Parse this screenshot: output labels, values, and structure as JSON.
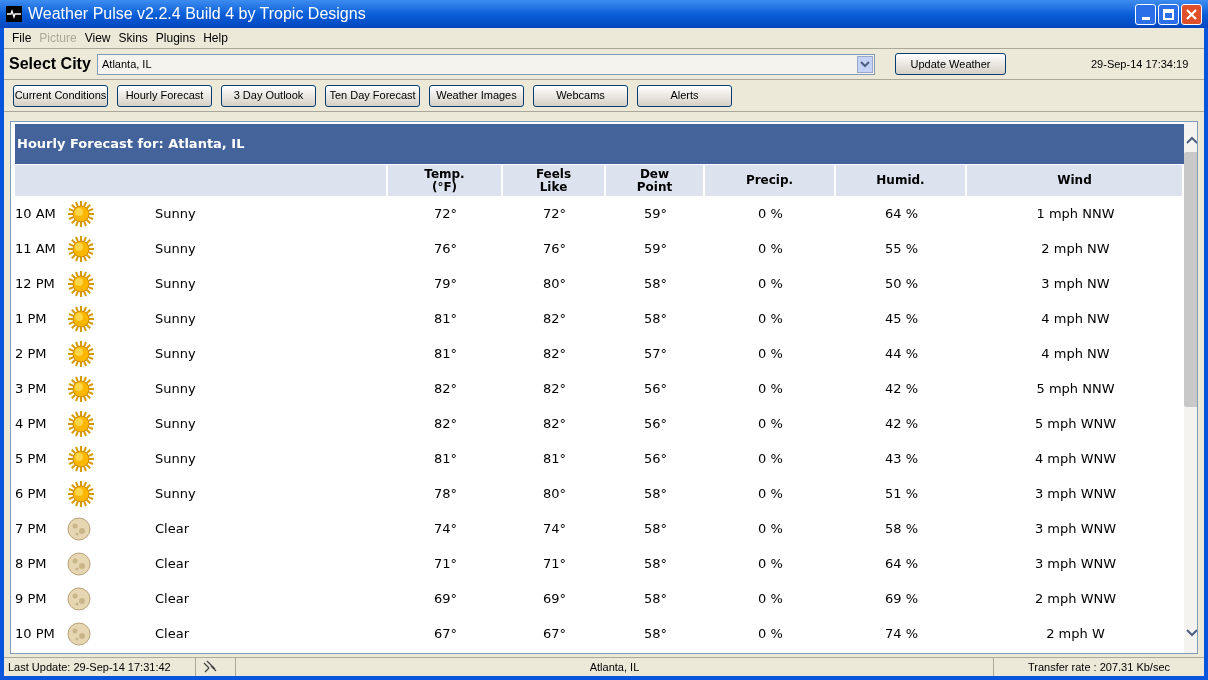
{
  "window": {
    "title": "Weather Pulse v2.2.4 Build 4 by Tropic Designs"
  },
  "menu": [
    {
      "label": "File",
      "disabled": false
    },
    {
      "label": "Picture",
      "disabled": true
    },
    {
      "label": "View",
      "disabled": false
    },
    {
      "label": "Skins",
      "disabled": false
    },
    {
      "label": "Plugins",
      "disabled": false
    },
    {
      "label": "Help",
      "disabled": false
    }
  ],
  "city_bar": {
    "label": "Select City",
    "value": "Atlanta, IL",
    "button": "Update Weather",
    "datetime": "29-Sep-14 17:34:19"
  },
  "view_buttons": [
    "Current Conditions",
    "Hourly Forecast",
    "3 Day Outlook",
    "Ten Day Forecast",
    "Weather Images",
    "Webcams",
    "Alerts"
  ],
  "forecast": {
    "title": "Hourly Forecast for: Atlanta, IL",
    "columns": [
      "Temp.\n(°F)",
      "Feels\nLike",
      "Dew\nPoint",
      "Precip.",
      "Humid.",
      "Wind"
    ],
    "rows": [
      {
        "time": "10 AM",
        "kind": "day",
        "condition": "Sunny",
        "temp": "72°",
        "feels": "72°",
        "dew": "59°",
        "precip": "0 %",
        "humid": "64 %",
        "wind": "1 mph NNW"
      },
      {
        "time": "11 AM",
        "kind": "day",
        "condition": "Sunny",
        "temp": "76°",
        "feels": "76°",
        "dew": "59°",
        "precip": "0 %",
        "humid": "55 %",
        "wind": "2 mph NW"
      },
      {
        "time": "12 PM",
        "kind": "day",
        "condition": "Sunny",
        "temp": "79°",
        "feels": "80°",
        "dew": "58°",
        "precip": "0 %",
        "humid": "50 %",
        "wind": "3 mph NW"
      },
      {
        "time": "1 PM",
        "kind": "day",
        "condition": "Sunny",
        "temp": "81°",
        "feels": "82°",
        "dew": "58°",
        "precip": "0 %",
        "humid": "45 %",
        "wind": "4 mph NW"
      },
      {
        "time": "2 PM",
        "kind": "day",
        "condition": "Sunny",
        "temp": "81°",
        "feels": "82°",
        "dew": "57°",
        "precip": "0 %",
        "humid": "44 %",
        "wind": "4 mph NW"
      },
      {
        "time": "3 PM",
        "kind": "day",
        "condition": "Sunny",
        "temp": "82°",
        "feels": "82°",
        "dew": "56°",
        "precip": "0 %",
        "humid": "42 %",
        "wind": "5 mph NNW"
      },
      {
        "time": "4 PM",
        "kind": "day",
        "condition": "Sunny",
        "temp": "82°",
        "feels": "82°",
        "dew": "56°",
        "precip": "0 %",
        "humid": "42 %",
        "wind": "5 mph WNW"
      },
      {
        "time": "5 PM",
        "kind": "day",
        "condition": "Sunny",
        "temp": "81°",
        "feels": "81°",
        "dew": "56°",
        "precip": "0 %",
        "humid": "43 %",
        "wind": "4 mph WNW"
      },
      {
        "time": "6 PM",
        "kind": "day",
        "condition": "Sunny",
        "temp": "78°",
        "feels": "80°",
        "dew": "58°",
        "precip": "0 %",
        "humid": "51 %",
        "wind": "3 mph WNW"
      },
      {
        "time": "7 PM",
        "kind": "night",
        "condition": "Clear",
        "temp": "74°",
        "feels": "74°",
        "dew": "58°",
        "precip": "0 %",
        "humid": "58 %",
        "wind": "3 mph WNW"
      },
      {
        "time": "8 PM",
        "kind": "night",
        "condition": "Clear",
        "temp": "71°",
        "feels": "71°",
        "dew": "58°",
        "precip": "0 %",
        "humid": "64 %",
        "wind": "3 mph WNW"
      },
      {
        "time": "9 PM",
        "kind": "night",
        "condition": "Clear",
        "temp": "69°",
        "feels": "69°",
        "dew": "58°",
        "precip": "0 %",
        "humid": "69 %",
        "wind": "2 mph WNW"
      },
      {
        "time": "10 PM",
        "kind": "night",
        "condition": "Clear",
        "temp": "67°",
        "feels": "67°",
        "dew": "58°",
        "precip": "0 %",
        "humid": "74 %",
        "wind": "2 mph W"
      }
    ]
  },
  "status_bar": {
    "last_update": "Last Update: 29-Sep-14 17:31:42",
    "city": "Atlanta, IL",
    "transfer": "Transfer rate : 207.31 Kb/sec"
  }
}
